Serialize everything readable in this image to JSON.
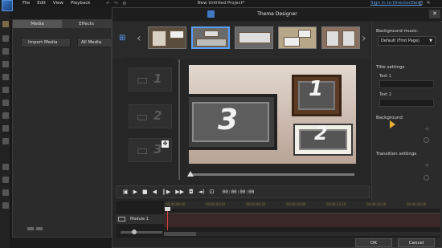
{
  "menubar": {
    "items": [
      "File",
      "Edit",
      "View",
      "Playback"
    ],
    "project_title": "New Untitled Project*",
    "signin_link": "Sign in to DirectorZone"
  },
  "media_panel": {
    "tabs": [
      "Media",
      "Effects"
    ],
    "import_label": "Import Media",
    "filter_value": "All Media"
  },
  "dialog": {
    "title": "Theme Designer",
    "close_label": "✕",
    "ok_label": "OK",
    "cancel_label": "Cancel"
  },
  "settings": {
    "bg_music_label": "Background music:",
    "bg_music_value": "Default (First Page)",
    "title_settings_label": "Title settings",
    "text1_label": "Text 1",
    "text2_label": "Text 2",
    "background_label": "Background",
    "transition_label": "Transition settings"
  },
  "slots": [
    "1",
    "2",
    "3"
  ],
  "preview": {
    "frame_big_num": "3",
    "frame_1_num": "1",
    "frame_2_num": "2"
  },
  "controls": {
    "timecode": "00:00:00:00"
  },
  "timeline": {
    "track_name": "Module 1",
    "ticks": [
      "00;00;00;00",
      "00;00;03;10",
      "00;00;06;20",
      "00;00;10;00",
      "00;00;13;10",
      "00;00;16;20",
      "00;00;20;00"
    ]
  },
  "colors": {
    "accent_blue": "#5aa0ff",
    "playhead_red": "#d84040"
  }
}
